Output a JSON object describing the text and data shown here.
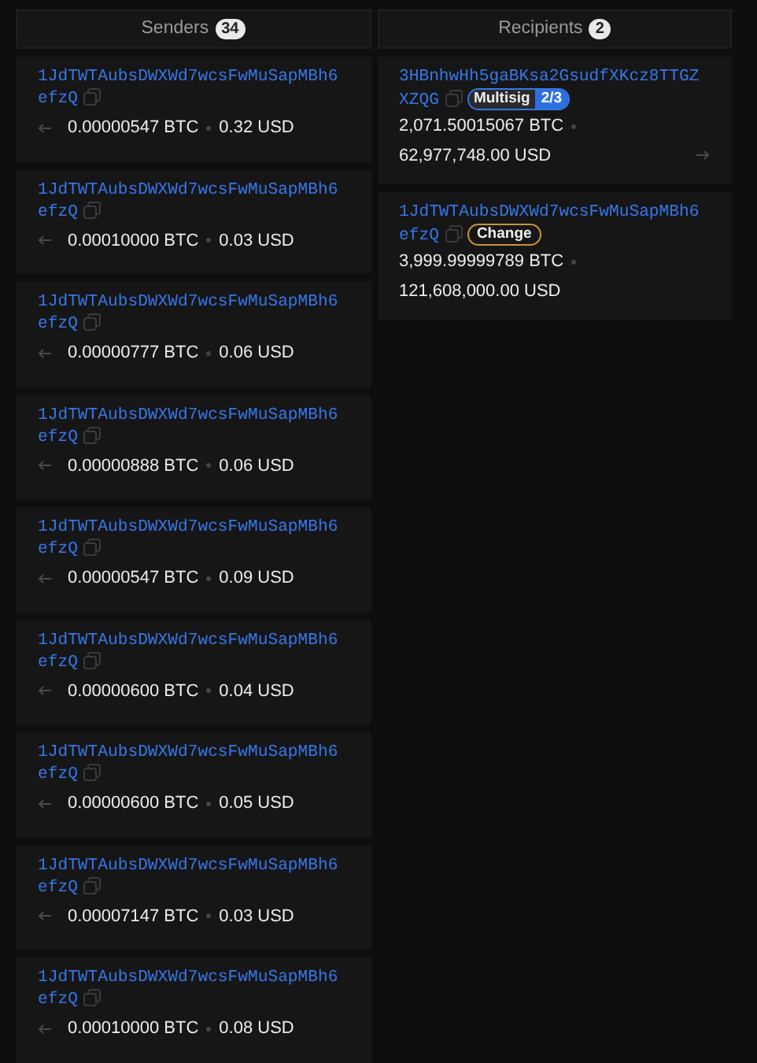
{
  "senders": {
    "title": "Senders",
    "count": "34",
    "items": [
      {
        "address": {
          "line_1": "1JdTWTAubsDWXWd7wcsFwMuSapMBh6",
          "line_2": "efzQ"
        },
        "btc": "0.00000547 BTC",
        "usd": "0.32 USD"
      },
      {
        "address": {
          "line_1": "1JdTWTAubsDWXWd7wcsFwMuSapMBh6",
          "line_2": "efzQ"
        },
        "btc": "0.00010000 BTC",
        "usd": "0.03 USD"
      },
      {
        "address": {
          "line_1": "1JdTWTAubsDWXWd7wcsFwMuSapMBh6",
          "line_2": "efzQ"
        },
        "btc": "0.00000777 BTC",
        "usd": "0.06 USD"
      },
      {
        "address": {
          "line_1": "1JdTWTAubsDWXWd7wcsFwMuSapMBh6",
          "line_2": "efzQ"
        },
        "btc": "0.00000888 BTC",
        "usd": "0.06 USD"
      },
      {
        "address": {
          "line_1": "1JdTWTAubsDWXWd7wcsFwMuSapMBh6",
          "line_2": "efzQ"
        },
        "btc": "0.00000547 BTC",
        "usd": "0.09 USD"
      },
      {
        "address": {
          "line_1": "1JdTWTAubsDWXWd7wcsFwMuSapMBh6",
          "line_2": "efzQ"
        },
        "btc": "0.00000600 BTC",
        "usd": "0.04 USD"
      },
      {
        "address": {
          "line_1": "1JdTWTAubsDWXWd7wcsFwMuSapMBh6",
          "line_2": "efzQ"
        },
        "btc": "0.00000600 BTC",
        "usd": "0.05 USD"
      },
      {
        "address": {
          "line_1": "1JdTWTAubsDWXWd7wcsFwMuSapMBh6",
          "line_2": "efzQ"
        },
        "btc": "0.00007147 BTC",
        "usd": "0.03 USD"
      },
      {
        "address": {
          "line_1": "1JdTWTAubsDWXWd7wcsFwMuSapMBh6",
          "line_2": "efzQ"
        },
        "btc": "0.00010000 BTC",
        "usd": "0.08 USD"
      }
    ]
  },
  "recipients": {
    "title": "Recipients",
    "count": "2",
    "items": [
      {
        "address": {
          "line_1": "3HBnhwHh5gaBKsa2GsudfXKcz8TTGZ",
          "line_2": "XZQG"
        },
        "badge": {
          "kind": "multisig",
          "label": "Multisig",
          "value": "2/3"
        },
        "btc": "2,071.50015067 BTC",
        "usd": "62,977,748.00 USD",
        "spent": true
      },
      {
        "address": {
          "line_1": "1JdTWTAubsDWXWd7wcsFwMuSapMBh6",
          "line_2": "efzQ"
        },
        "badge": {
          "kind": "change",
          "label": "Change"
        },
        "btc": "3,999.99999789 BTC",
        "usd": "121,608,000.00 USD",
        "spent": false
      }
    ]
  }
}
